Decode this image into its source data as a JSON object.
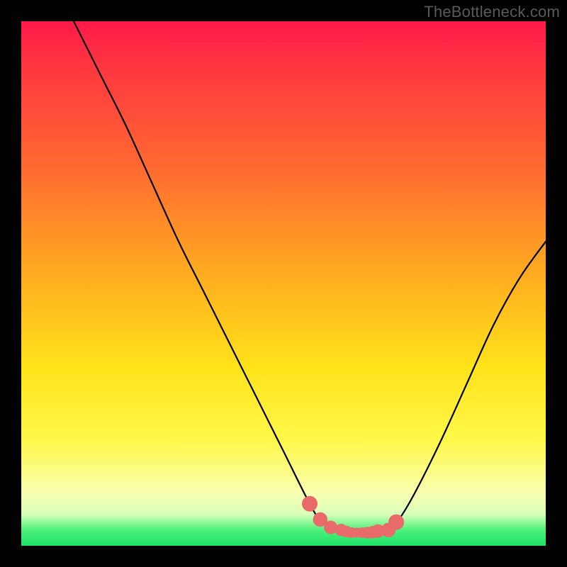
{
  "watermark": "TheBottleneck.com",
  "chart_data": {
    "type": "line",
    "title": "",
    "xlabel": "",
    "ylabel": "",
    "xlim": [
      0,
      100
    ],
    "ylim": [
      0,
      100
    ],
    "series": [
      {
        "name": "curve",
        "x": [
          10,
          15,
          20,
          25,
          30,
          35,
          40,
          45,
          50,
          55,
          57,
          60,
          63,
          66,
          70,
          72,
          75,
          80,
          85,
          90,
          95,
          100
        ],
        "y": [
          100,
          90,
          80,
          69,
          58,
          48,
          38,
          28,
          18,
          8,
          5,
          3,
          2.5,
          2.5,
          3,
          5,
          10,
          20,
          31,
          42,
          51,
          58
        ]
      },
      {
        "name": "highlight-dots",
        "x": [
          55,
          57,
          59,
          61,
          62,
          63,
          64,
          65,
          66,
          67,
          68,
          70,
          71.5
        ],
        "y": [
          8,
          5,
          3.5,
          3,
          2.7,
          2.5,
          2.5,
          2.5,
          2.5,
          2.6,
          2.8,
          3,
          4.5
        ]
      }
    ],
    "gradient_colors": [
      "#ff1a49",
      "#ff6a30",
      "#ffe31a",
      "#f8ffb0",
      "#1fe36a"
    ]
  }
}
